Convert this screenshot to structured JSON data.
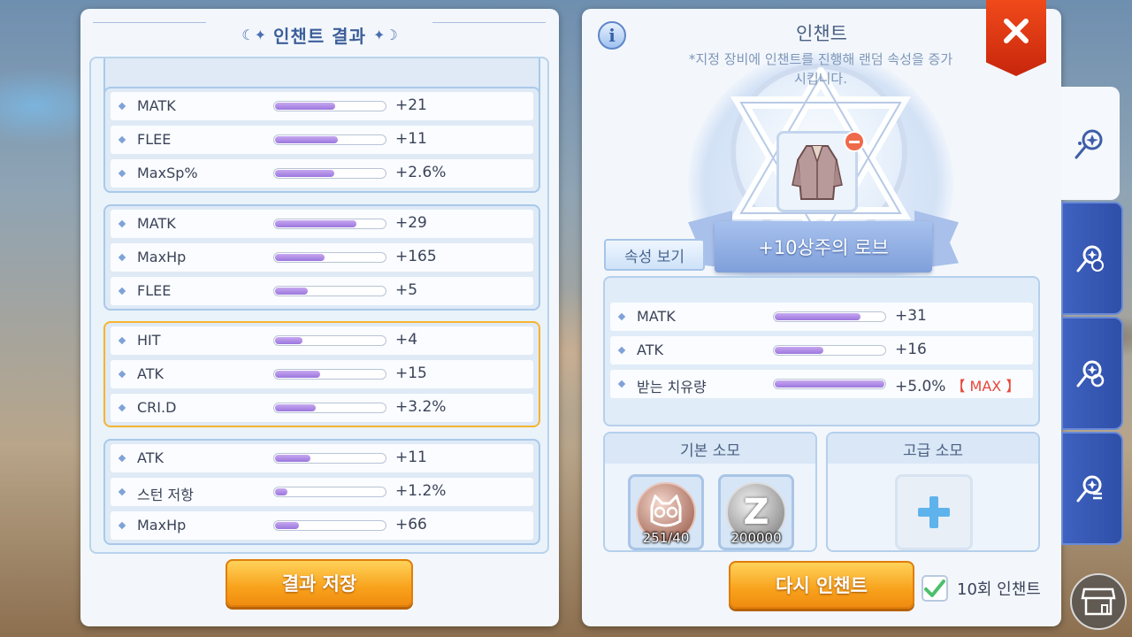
{
  "left_panel": {
    "title": "인챈트 결과",
    "groups": [
      {
        "selected": false,
        "stats": [
          {
            "name": "MATK",
            "value": "+21",
            "fill": 0.55
          },
          {
            "name": "FLEE",
            "value": "+11",
            "fill": 0.57
          },
          {
            "name": "MaxSp%",
            "value": "+2.6%",
            "fill": 0.54
          }
        ]
      },
      {
        "selected": false,
        "stats": [
          {
            "name": "MATK",
            "value": "+29",
            "fill": 0.74
          },
          {
            "name": "MaxHp",
            "value": "+165",
            "fill": 0.45
          },
          {
            "name": "FLEE",
            "value": "+5",
            "fill": 0.3
          }
        ]
      },
      {
        "selected": true,
        "stats": [
          {
            "name": "HIT",
            "value": "+4",
            "fill": 0.25
          },
          {
            "name": "ATK",
            "value": "+15",
            "fill": 0.41
          },
          {
            "name": "CRI.D",
            "value": "+3.2%",
            "fill": 0.37
          }
        ]
      },
      {
        "selected": false,
        "stats": [
          {
            "name": "ATK",
            "value": "+11",
            "fill": 0.32
          },
          {
            "name": "스턴 저항",
            "value": "+1.2%",
            "fill": 0.11
          },
          {
            "name": "MaxHp",
            "value": "+66",
            "fill": 0.22
          }
        ]
      }
    ],
    "save_button": "결과 저장"
  },
  "right_panel": {
    "title": "인챈트",
    "description_line1": "*지정 장비에 인챈트를 진행해 랜덤 속성을 증가",
    "description_line2": "시킵니다.",
    "info_icon": "i",
    "item_name": "+10상주의 로브",
    "attribute_button": "속성 보기",
    "current_stats": [
      {
        "name": "MATK",
        "value": "+31",
        "fill": 0.78,
        "max": ""
      },
      {
        "name": "ATK",
        "value": "+16",
        "fill": 0.44,
        "max": ""
      },
      {
        "name": "받는 치유량",
        "value": "+5.0%",
        "fill": 1.0,
        "max": "【 MAX 】"
      }
    ],
    "basic_cost": {
      "title": "기본 소모",
      "materials": [
        {
          "icon": "cat-coin-icon",
          "count": "251/40"
        },
        {
          "icon": "zeny-coin-icon",
          "count": "200000"
        }
      ]
    },
    "advanced_cost": {
      "title": "고급 소모"
    },
    "reenchant_button": "다시 인챈트",
    "repeat_label": "10회 인챈트",
    "repeat_checked": true
  },
  "side_tabs": [
    "enchant-tab-1",
    "enchant-tab-2",
    "enchant-tab-3",
    "enchant-tab-4"
  ],
  "colors": {
    "accent": "#f5b431",
    "bar": "#9b76dd",
    "tab": "#3e62c0",
    "close": "#e2391a"
  }
}
